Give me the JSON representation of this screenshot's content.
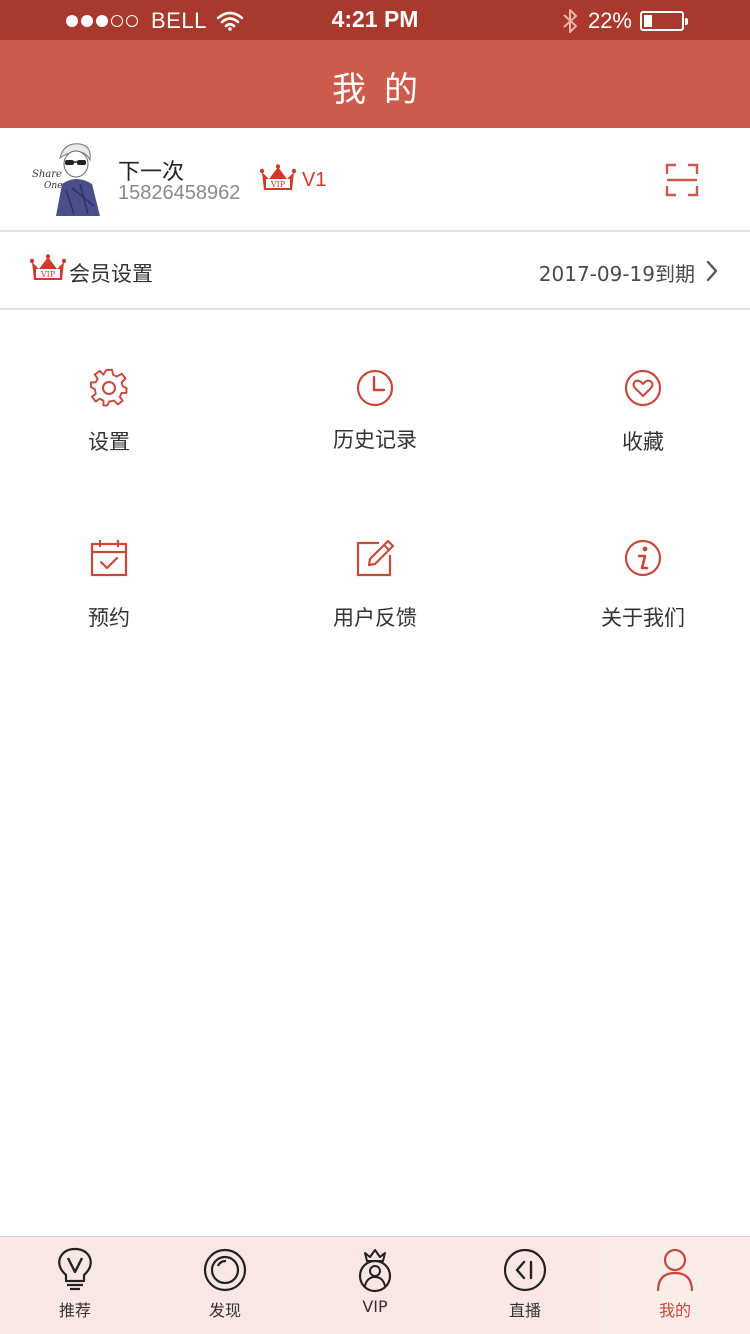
{
  "status_bar": {
    "carrier": "BELL",
    "signal_bars_filled": 3,
    "signal_bars_total": 5,
    "time": "4:21 PM",
    "battery_percent": "22%",
    "battery_level": 0.22
  },
  "nav": {
    "title": "我的"
  },
  "profile": {
    "name": "下一次",
    "phone": "15826458962",
    "vip_badge": "VIP",
    "vip_level": "V1",
    "avatar_text_1": "Share",
    "avatar_text_2": "One"
  },
  "member": {
    "label": "会员设置",
    "expiry": "2017-09-19到期"
  },
  "grid": [
    {
      "label": "设置",
      "icon": "gear-icon"
    },
    {
      "label": "历史记录",
      "icon": "clock-icon"
    },
    {
      "label": "收藏",
      "icon": "heart-icon"
    },
    {
      "label": "预约",
      "icon": "calendar-check-icon"
    },
    {
      "label": "用户反馈",
      "icon": "edit-icon"
    },
    {
      "label": "关于我们",
      "icon": "info-icon"
    }
  ],
  "tabs": [
    {
      "label": "推荐",
      "icon": "bulb-icon",
      "active": false
    },
    {
      "label": "发现",
      "icon": "discover-icon",
      "active": false
    },
    {
      "label": "VIP",
      "icon": "vip-person-icon",
      "active": false
    },
    {
      "label": "直播",
      "icon": "live-back-icon",
      "active": false
    },
    {
      "label": "我的",
      "icon": "person-icon",
      "active": true
    }
  ],
  "colors": {
    "status_bar": "#a8392c",
    "nav_bar": "#cd5a4a",
    "accent": "#c9483a",
    "vip_red": "#d2392a",
    "tab_bar": "#fae7e5"
  }
}
